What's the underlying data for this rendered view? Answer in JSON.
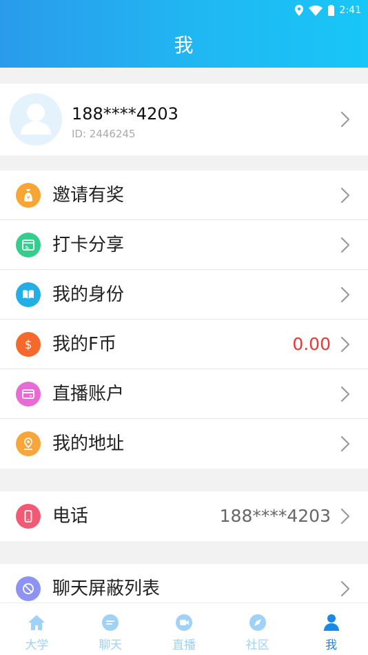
{
  "status_bar": {
    "time": "2:41"
  },
  "header": {
    "title": "我"
  },
  "profile": {
    "phone": "188****4203",
    "user_id": "ID: 2446245"
  },
  "menu_group_1": [
    {
      "label": "邀请有奖",
      "icon": "money-bag-icon",
      "color": "#f7a535"
    },
    {
      "label": "打卡分享",
      "icon": "calendar-check-icon",
      "color": "#35cd8c"
    },
    {
      "label": "我的身份",
      "icon": "book-icon",
      "color": "#23aee6"
    },
    {
      "label": "我的F币",
      "icon": "dollar-coin-icon",
      "color": "#f56a2a",
      "value": "0.00"
    },
    {
      "label": "直播账户",
      "icon": "card-icon",
      "color": "#e66bd4"
    },
    {
      "label": "我的地址",
      "icon": "location-pin-icon",
      "color": "#f8a53a"
    }
  ],
  "menu_group_2": [
    {
      "label": "电话",
      "icon": "phone-icon",
      "color": "#f25a73",
      "value": "188****4203"
    }
  ],
  "menu_group_3": [
    {
      "label": "聊天屏蔽列表",
      "icon": "block-icon",
      "color": "#8c93f0"
    }
  ],
  "tabbar": [
    {
      "label": "大学",
      "icon": "home-icon",
      "active": false
    },
    {
      "label": "聊天",
      "icon": "chat-icon",
      "active": false
    },
    {
      "label": "直播",
      "icon": "video-icon",
      "active": false
    },
    {
      "label": "社区",
      "icon": "compass-icon",
      "active": false
    },
    {
      "label": "我",
      "icon": "person-icon",
      "active": true
    }
  ],
  "colors": {
    "accent": "#1a88e6",
    "header_start": "#2a9bea",
    "header_end": "#18c6f7",
    "value_red": "#e53935",
    "tab_inactive": "#9fd2f6"
  }
}
